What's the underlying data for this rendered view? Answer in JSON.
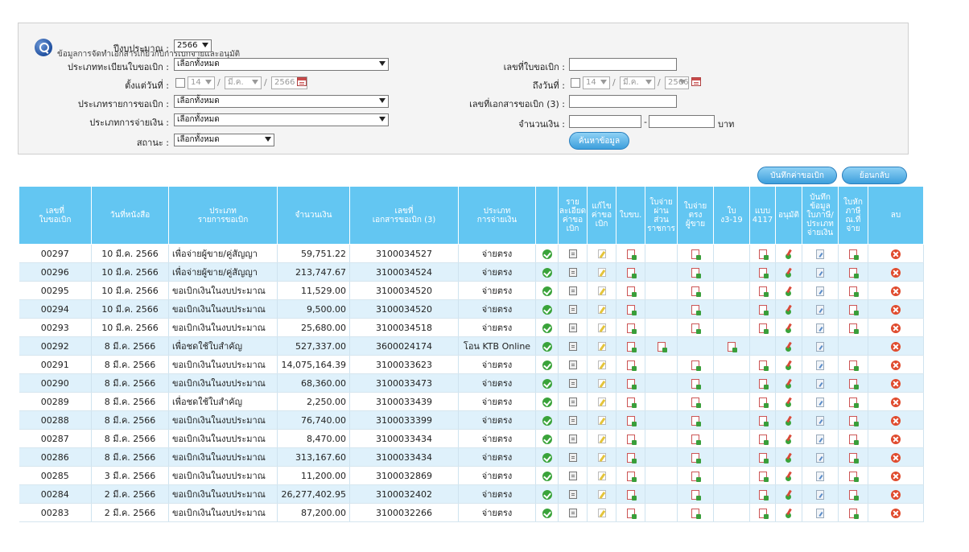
{
  "panel": {
    "title": "ข้อมูลการจัดทำเอกสารเกี่ยวกับการเบิกจ่ายและอนุมัติ",
    "fiscal_year_label": "ปีงบประมาณ :",
    "fiscal_year_value": "2566",
    "request_type_label": "ประเภททะเบียนใบขอเบิก :",
    "request_type_value": "เลือกทั้งหมด",
    "from_date_label": "ตั้งแต่วันที่ :",
    "from_day": "14",
    "from_month": "มี.ค.",
    "from_year": "2566",
    "item_type_label": "ประเภทรายการขอเบิก :",
    "item_type_value": "เลือกทั้งหมด",
    "payment_type_label": "ประเภทการจ่ายเงิน :",
    "payment_type_value": "เลือกทั้งหมด",
    "status_label": "สถานะ :",
    "status_value": "เลือกทั้งหมด",
    "request_no_label": "เลขที่ใบขอเบิก :",
    "request_no_value": "",
    "to_date_label": "ถึงวันที่ :",
    "to_day": "14",
    "to_month": "มี.ค.",
    "to_year": "2566",
    "doc_no_label": "เลขที่เอกสารขอเบิก (3) :",
    "doc_no_value": "",
    "amount_label": "จำนวนเงิน :",
    "amount_from": "",
    "amount_dash": "-",
    "amount_to": "",
    "amount_unit": "บาท",
    "search_button": "ค้นหาข้อมูล"
  },
  "actions": {
    "record_button": "บันทึกค่าขอเบิก",
    "back_button": "ย้อนกลับ"
  },
  "table": {
    "headers": [
      "เลขที่\nใบขอเบิก",
      "วันที่หนังสือ",
      "ประเภท\nรายการขอเบิก",
      "จำนวนเงิน",
      "เลขที่\nเอกสารขอเบิก (3)",
      "ประเภท\nการจ่ายเงิน",
      "",
      "ราย\nละเอียด\nค่าขอ\nเบิก",
      "แก้ไข\nค่าขอ\nเบิก",
      "ใบขบ.",
      "ใบจ่าย\nผ่าน\nส่วน\nราชการ",
      "ใบจ่าย\nตรง\nผู้ขาย",
      "ใบ\nง3-19",
      "แบบ\n4117",
      "อนุมัติ",
      "บันทึก\nข้อมูล\nใบภาษี/\nประเภท\nจ่ายเงิน",
      "ใบหัก\nภาษี\nณ.ที่\nจ่าย",
      "ลบ"
    ],
    "rows": [
      {
        "no": "00297",
        "date": "10 มี.ค. 2566",
        "type": "เพื่อจ่ายผู้ขาย/คู่สัญญา",
        "amount": "59,751.22",
        "doc": "3100034527",
        "pay": "จ่ายตรง",
        "icons": {
          "via": false,
          "direct": true,
          "g319": false,
          "f4117": true,
          "tax": true
        }
      },
      {
        "no": "00296",
        "date": "10 มี.ค. 2566",
        "type": "เพื่อจ่ายผู้ขาย/คู่สัญญา",
        "amount": "213,747.67",
        "doc": "3100034524",
        "pay": "จ่ายตรง",
        "icons": {
          "via": false,
          "direct": true,
          "g319": false,
          "f4117": true,
          "tax": true
        }
      },
      {
        "no": "00295",
        "date": "10 มี.ค. 2566",
        "type": "ขอเบิกเงินในงบประมาณ",
        "amount": "11,529.00",
        "doc": "3100034520",
        "pay": "จ่ายตรง",
        "icons": {
          "via": false,
          "direct": true,
          "g319": false,
          "f4117": true,
          "tax": true
        }
      },
      {
        "no": "00294",
        "date": "10 มี.ค. 2566",
        "type": "ขอเบิกเงินในงบประมาณ",
        "amount": "9,500.00",
        "doc": "3100034520",
        "pay": "จ่ายตรง",
        "icons": {
          "via": false,
          "direct": true,
          "g319": false,
          "f4117": true,
          "tax": true
        }
      },
      {
        "no": "00293",
        "date": "10 มี.ค. 2566",
        "type": "ขอเบิกเงินในงบประมาณ",
        "amount": "25,680.00",
        "doc": "3100034518",
        "pay": "จ่ายตรง",
        "icons": {
          "via": false,
          "direct": true,
          "g319": false,
          "f4117": true,
          "tax": true
        }
      },
      {
        "no": "00292",
        "date": "8 มี.ค. 2566",
        "type": "เพื่อชดใช้ใบสำคัญ",
        "amount": "527,337.00",
        "doc": "3600024174",
        "pay": "โอน KTB Online",
        "icons": {
          "via": true,
          "direct": false,
          "g319": true,
          "f4117": false,
          "tax": false
        }
      },
      {
        "no": "00291",
        "date": "8 มี.ค. 2566",
        "type": "ขอเบิกเงินในงบประมาณ",
        "amount": "14,075,164.39",
        "doc": "3100033623",
        "pay": "จ่ายตรง",
        "icons": {
          "via": false,
          "direct": true,
          "g319": false,
          "f4117": true,
          "tax": true
        }
      },
      {
        "no": "00290",
        "date": "8 มี.ค. 2566",
        "type": "ขอเบิกเงินในงบประมาณ",
        "amount": "68,360.00",
        "doc": "3100033473",
        "pay": "จ่ายตรง",
        "icons": {
          "via": false,
          "direct": true,
          "g319": false,
          "f4117": true,
          "tax": true
        }
      },
      {
        "no": "00289",
        "date": "8 มี.ค. 2566",
        "type": "เพื่อชดใช้ใบสำคัญ",
        "amount": "2,250.00",
        "doc": "3100033439",
        "pay": "จ่ายตรง",
        "icons": {
          "via": false,
          "direct": true,
          "g319": false,
          "f4117": true,
          "tax": true
        }
      },
      {
        "no": "00288",
        "date": "8 มี.ค. 2566",
        "type": "ขอเบิกเงินในงบประมาณ",
        "amount": "76,740.00",
        "doc": "3100033399",
        "pay": "จ่ายตรง",
        "icons": {
          "via": false,
          "direct": true,
          "g319": false,
          "f4117": true,
          "tax": true
        }
      },
      {
        "no": "00287",
        "date": "8 มี.ค. 2566",
        "type": "ขอเบิกเงินในงบประมาณ",
        "amount": "8,470.00",
        "doc": "3100033434",
        "pay": "จ่ายตรง",
        "icons": {
          "via": false,
          "direct": true,
          "g319": false,
          "f4117": true,
          "tax": true
        }
      },
      {
        "no": "00286",
        "date": "8 มี.ค. 2566",
        "type": "ขอเบิกเงินในงบประมาณ",
        "amount": "313,167.60",
        "doc": "3100033434",
        "pay": "จ่ายตรง",
        "icons": {
          "via": false,
          "direct": true,
          "g319": false,
          "f4117": true,
          "tax": true
        }
      },
      {
        "no": "00285",
        "date": "3 มี.ค. 2566",
        "type": "ขอเบิกเงินในงบประมาณ",
        "amount": "11,200.00",
        "doc": "3100032869",
        "pay": "จ่ายตรง",
        "icons": {
          "via": false,
          "direct": true,
          "g319": false,
          "f4117": true,
          "tax": true
        }
      },
      {
        "no": "00284",
        "date": "2 มี.ค. 2566",
        "type": "ขอเบิกเงินในงบประมาณ",
        "amount": "26,277,402.95",
        "doc": "3100032402",
        "pay": "จ่ายตรง",
        "icons": {
          "via": false,
          "direct": true,
          "g319": false,
          "f4117": true,
          "tax": true
        }
      },
      {
        "no": "00283",
        "date": "2 มี.ค. 2566",
        "type": "ขอเบิกเงินในงบประมาณ",
        "amount": "87,200.00",
        "doc": "3100032266",
        "pay": "จ่ายตรง",
        "icons": {
          "via": false,
          "direct": true,
          "g319": false,
          "f4117": true,
          "tax": true
        }
      }
    ]
  }
}
